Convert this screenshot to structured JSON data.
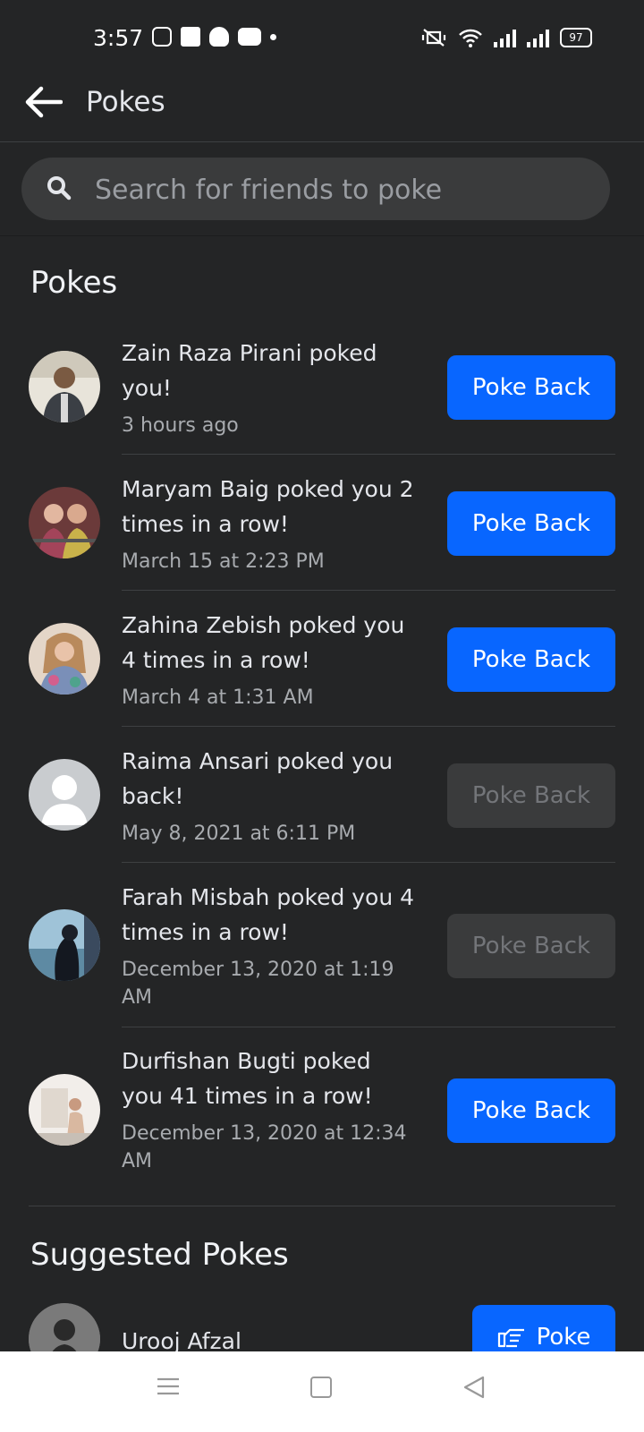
{
  "status_bar": {
    "time": "3:57",
    "icons": [
      "instagram-icon",
      "facebook-icon",
      "snapchat-icon",
      "youtube-icon",
      "dot-icon"
    ],
    "battery": "97"
  },
  "header": {
    "title": "Pokes"
  },
  "search": {
    "placeholder": "Search for friends to poke"
  },
  "pokes": {
    "section_title": "Pokes",
    "items": [
      {
        "text": "Zain Raza Pirani poked you!",
        "time": "3 hours ago",
        "button": "Poke Back",
        "enabled": true
      },
      {
        "text": "Maryam Baig poked you 2 times in a row!",
        "time": "March 15 at 2:23 PM",
        "button": "Poke Back",
        "enabled": true
      },
      {
        "text": "Zahina Zebish poked you 4 times in a row!",
        "time": "March 4 at 1:31 AM",
        "button": "Poke Back",
        "enabled": true
      },
      {
        "text": "Raima Ansari poked you back!",
        "time": "May 8, 2021 at 6:11 PM",
        "button": "Poke Back",
        "enabled": false
      },
      {
        "text": "Farah Misbah poked you 4 times in a row!",
        "time": "December 13, 2020 at 1:19 AM",
        "button": "Poke Back",
        "enabled": false
      },
      {
        "text": "Durfishan Bugti poked you 41 times in a row!",
        "time": "December 13, 2020 at 12:34 AM",
        "button": "Poke Back",
        "enabled": true
      }
    ]
  },
  "suggested": {
    "section_title": "Suggested Pokes",
    "items": [
      {
        "name": "Urooj Afzal",
        "button": "Poke"
      }
    ]
  },
  "colors": {
    "background": "#242526",
    "accent": "#0866ff",
    "disabled_button": "#3a3b3c"
  }
}
